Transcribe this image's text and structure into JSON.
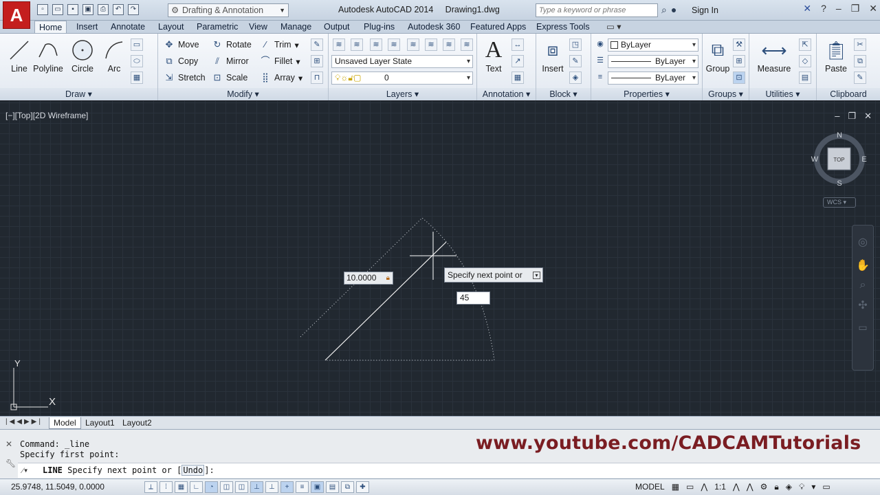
{
  "app": {
    "title": "Autodesk AutoCAD 2014",
    "document": "Drawing1.dwg",
    "logo_letter": "A",
    "workspace": "Drafting & Annotation",
    "search_placeholder": "Type a keyword or phrase",
    "signin": "Sign In",
    "brand_color": "#c41e1e"
  },
  "tabs": [
    "Home",
    "Insert",
    "Annotate",
    "Layout",
    "Parametric",
    "View",
    "Manage",
    "Output",
    "Plug-ins",
    "Autodesk 360",
    "Featured Apps",
    "Express Tools"
  ],
  "active_tab": "Home",
  "ribbon": {
    "draw": {
      "label": "Draw",
      "line": "Line",
      "polyline": "Polyline",
      "circle": "Circle",
      "arc": "Arc"
    },
    "modify": {
      "label": "Modify",
      "move": "Move",
      "rotate": "Rotate",
      "trim": "Trim",
      "copy": "Copy",
      "mirror": "Mirror",
      "fillet": "Fillet",
      "stretch": "Stretch",
      "scale": "Scale",
      "array": "Array"
    },
    "layers": {
      "label": "Layers",
      "layer_state": "Unsaved Layer State",
      "current_layer": "0"
    },
    "annotation": {
      "label": "Annotation",
      "text": "Text"
    },
    "block": {
      "label": "Block",
      "insert": "Insert"
    },
    "properties": {
      "label": "Properties",
      "color": "ByLayer",
      "linetype": "ByLayer",
      "lineweight": "ByLayer"
    },
    "groups": {
      "label": "Groups",
      "group": "Group"
    },
    "utilities": {
      "label": "Utilities",
      "measure": "Measure"
    },
    "clipboard": {
      "label": "Clipboard",
      "paste": "Paste"
    }
  },
  "viewport": {
    "label": "[−][Top][2D Wireframe]",
    "viewcube": {
      "north": "N",
      "south": "S",
      "east": "E",
      "west": "W",
      "face": "TOP"
    },
    "wcs": "WCS",
    "ucs_x": "X",
    "ucs_y": "Y",
    "dimension_value": "10.0000",
    "prompt_tooltip": "Specify next point or",
    "dynamic_input": "45"
  },
  "layout_tabs": [
    "Model",
    "Layout1",
    "Layout2"
  ],
  "command": {
    "history": [
      "Command: _line",
      "Specify first point:"
    ],
    "current_cmd": "LINE",
    "current_prompt": "Specify next point or [",
    "option": "Undo",
    "prompt_end": "]:"
  },
  "watermark": "www.youtube.com/CADCAMTutorials",
  "status": {
    "coords": "25.9748, 11.5049, 0.0000",
    "space": "MODEL",
    "scale": "1:1"
  }
}
